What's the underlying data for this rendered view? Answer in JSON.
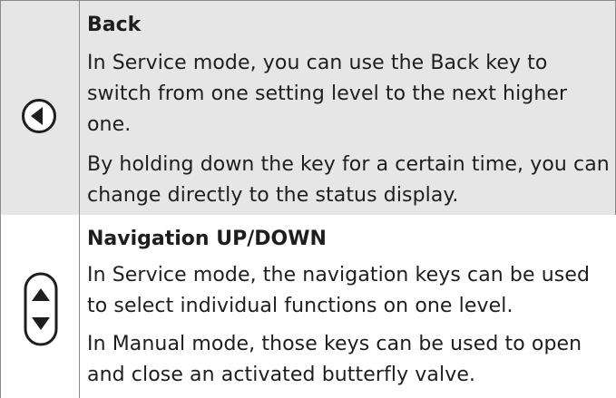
{
  "rows": [
    {
      "icon": "back-key-icon",
      "title": "Back",
      "paragraphs": [
        "In Service mode, you can use the Back key to switch from one setting level to the next higher one.",
        "By holding down the key for a certain time, you can change directly to the status display."
      ]
    },
    {
      "icon": "navigation-up-down-key-icon",
      "title": "Navigation UP/DOWN",
      "paragraphs": [
        "In Service mode, the navigation keys can be used to select individual functions on one level.",
        "In Manual mode, those keys can be used to open and close an activated butterfly valve."
      ]
    }
  ],
  "colors": {
    "shaded_cell": "#e6e6e6",
    "border": "#8a8a8a",
    "text": "#1e1e1e"
  }
}
